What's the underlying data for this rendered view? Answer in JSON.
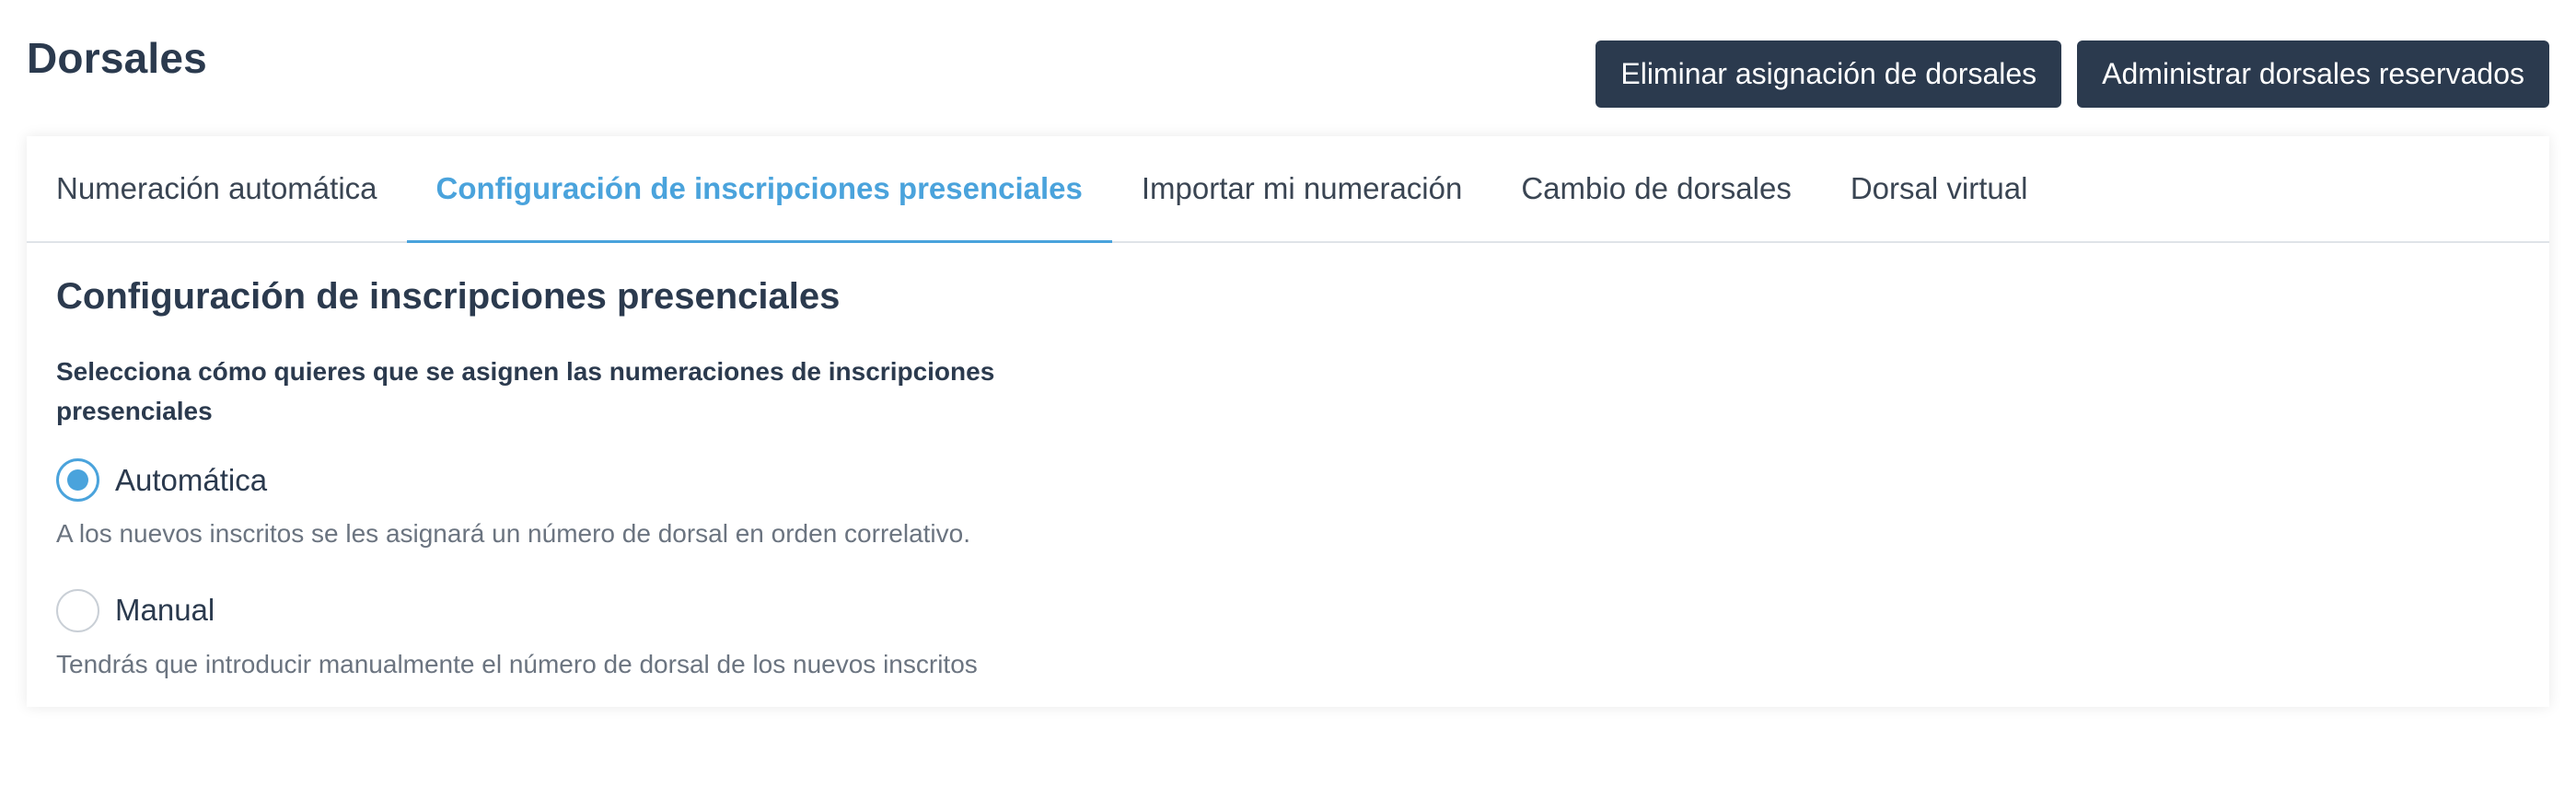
{
  "page": {
    "title": "Dorsales"
  },
  "actions": {
    "remove_assignment": "Eliminar asignación de dorsales",
    "manage_reserved": "Administrar dorsales reservados"
  },
  "tabs": [
    {
      "label": "Numeración automática",
      "active": false
    },
    {
      "label": "Configuración de inscripciones presenciales",
      "active": true
    },
    {
      "label": "Importar mi numeración",
      "active": false
    },
    {
      "label": "Cambio de dorsales",
      "active": false
    },
    {
      "label": "Dorsal virtual",
      "active": false
    }
  ],
  "panel": {
    "title": "Configuración de inscripciones presenciales",
    "question": "Selecciona cómo quieres que se asignen las numeraciones de inscripciones presenciales",
    "options": [
      {
        "label": "Automática",
        "description": "A los nuevos inscritos se les asignará un número de dorsal en orden correlativo.",
        "selected": true
      },
      {
        "label": "Manual",
        "description": "Tendrás que introducir manualmente el número de dorsal de los nuevos inscritos",
        "selected": false
      }
    ]
  },
  "colors": {
    "primary_dark": "#2b3a4e",
    "accent_blue": "#4aa3dc",
    "muted_text": "#6b7480"
  }
}
